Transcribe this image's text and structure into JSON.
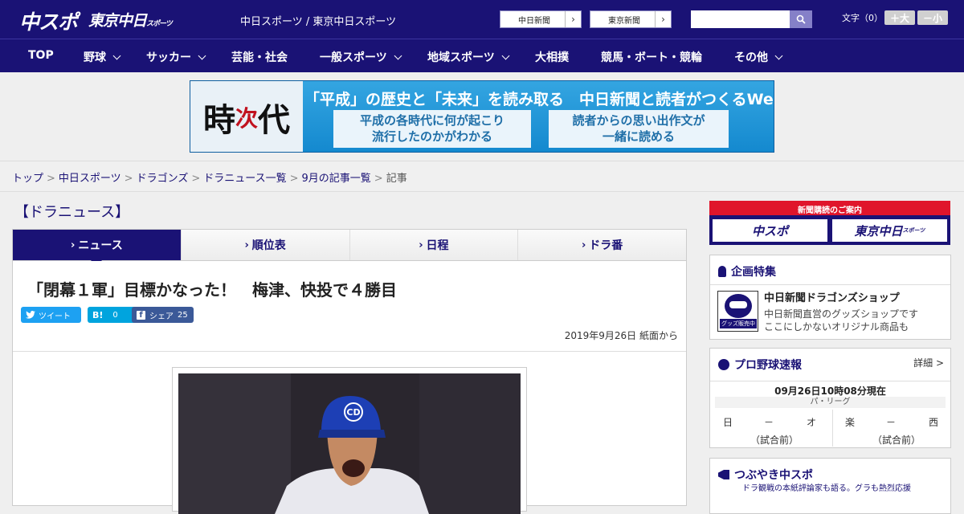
{
  "header": {
    "logo_chuspo": "中スポ",
    "logo_tokyo": "東京中日",
    "logo_tokyo_small": "スポーツ",
    "site_links": "中日スポーツ / 東京中日スポーツ",
    "paper_buttons": [
      "中日新聞",
      "東京新聞"
    ],
    "search": {
      "placeholder": "",
      "value": ""
    },
    "font_size_label": "文字（0）",
    "font_larger": "＋大",
    "font_smaller": "－小"
  },
  "nav": {
    "items": [
      {
        "label": "TOP",
        "dropdown": false
      },
      {
        "label": "野球",
        "dropdown": true
      },
      {
        "label": "サッカー",
        "dropdown": true
      },
      {
        "label": "芸能・社会",
        "dropdown": false
      },
      {
        "label": "一般スポーツ",
        "dropdown": true
      },
      {
        "label": "地域スポーツ",
        "dropdown": true
      },
      {
        "label": "大相撲",
        "dropdown": false
      },
      {
        "label": "競馬・ボート・競輪",
        "dropdown": false
      },
      {
        "label": "その他",
        "dropdown": true
      }
    ]
  },
  "banner": {
    "kanji_top": "時",
    "kanji_small": "次",
    "kanji_main": "代",
    "headline": "「平成」の歴史と「未来」を読み取る　中日新聞と読者がつくるWebサイト",
    "box_left_1": "平成の各時代に何が起こり",
    "box_left_2": "流行したのかがわかる",
    "box_right_1": "読者からの思い出作文が",
    "box_right_2": "一緒に読める"
  },
  "breadcrumb": {
    "items": [
      "トップ",
      "中日スポーツ",
      "ドラゴンズ",
      "ドラニュース一覧",
      "9月の記事一覧"
    ],
    "current": "記事"
  },
  "section_title": "【ドラニュース】",
  "tabs": [
    {
      "label": "ニュース",
      "active": true
    },
    {
      "label": "順位表",
      "active": false
    },
    {
      "label": "日程",
      "active": false
    },
    {
      "label": "ドラ番",
      "active": false
    }
  ],
  "article": {
    "headline": "「閉幕１軍」目標かなった！　梅津、快投で４勝目",
    "share": {
      "tweet_label": "ツイート",
      "hatena_label": "B!",
      "hatena_count": "0",
      "facebook_label": "シェア",
      "facebook_count": "25"
    },
    "dateline": "2019年9月26日 紙面から",
    "photo_cap_logo": "CD"
  },
  "sidebar": {
    "subscribe_title": "新聞購読のご案内",
    "subscribe_buttons": [
      "中スポ",
      "東京中日"
    ],
    "subscribe_small": "スポーツ",
    "feature_heading": "企画特集",
    "shop_title": "中日新聞ドラゴンズショップ",
    "shop_desc_1": "中日新聞直営のグッズショップです",
    "shop_desc_2": "ここにしかないオリジナル商品も",
    "shop_icon_tag": "グッズ販売中",
    "baseball_heading": "プロ野球速報",
    "baseball_detail": "詳細 >",
    "baseball_time": "09月26日10時08分現在",
    "league": "パ・リーグ",
    "games": [
      {
        "home": "日",
        "score": "－",
        "away": "オ",
        "status": "（試合前）"
      },
      {
        "home": "楽",
        "score": "－",
        "away": "西",
        "status": "（試合前）"
      }
    ],
    "tsubuyaki_heading": "つぶやき中スポ",
    "tsubuyaki_sub": "ドラ観戦の本紙評論家も語る。グラも熱烈応援"
  },
  "colors": {
    "brand_navy": "#1a1275",
    "twitter": "#1da1f2",
    "hatena": "#00a4de",
    "facebook": "#3b5998",
    "subscribe_red": "#e0152b"
  }
}
